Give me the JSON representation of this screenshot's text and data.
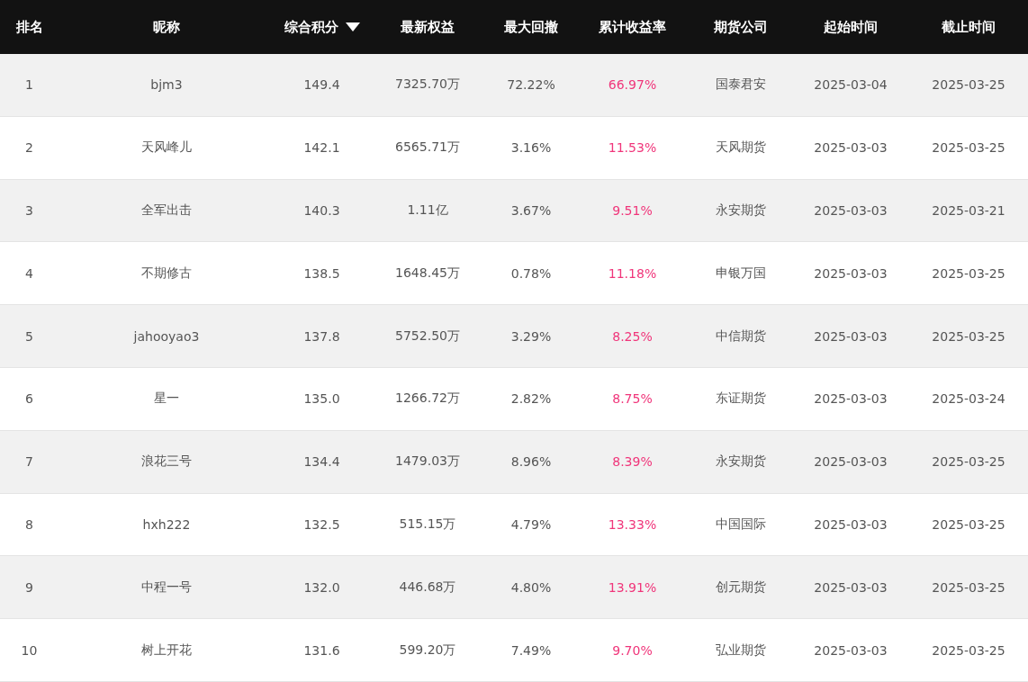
{
  "table": {
    "columns": [
      {
        "label": "排名"
      },
      {
        "label": "昵称"
      },
      {
        "label": "综合积分",
        "sorted": true
      },
      {
        "label": "最新权益"
      },
      {
        "label": "最大回撤"
      },
      {
        "label": "累计收益率"
      },
      {
        "label": "期货公司"
      },
      {
        "label": "起始时间"
      },
      {
        "label": "截止时间"
      }
    ],
    "rows": [
      [
        "1",
        "bjm3",
        "149.4",
        "7325.70万",
        "72.22%",
        "66.97%",
        "国泰君安",
        "2025-03-04",
        "2025-03-25"
      ],
      [
        "2",
        "天风峰儿",
        "142.1",
        "6565.71万",
        "3.16%",
        "11.53%",
        "天风期货",
        "2025-03-03",
        "2025-03-25"
      ],
      [
        "3",
        "全军出击",
        "140.3",
        "1.11亿",
        "3.67%",
        "9.51%",
        "永安期货",
        "2025-03-03",
        "2025-03-21"
      ],
      [
        "4",
        "不期修古",
        "138.5",
        "1648.45万",
        "0.78%",
        "11.18%",
        "申银万国",
        "2025-03-03",
        "2025-03-25"
      ],
      [
        "5",
        "jahooyao3",
        "137.8",
        "5752.50万",
        "3.29%",
        "8.25%",
        "中信期货",
        "2025-03-03",
        "2025-03-25"
      ],
      [
        "6",
        "星一",
        "135.0",
        "1266.72万",
        "2.82%",
        "8.75%",
        "东证期货",
        "2025-03-03",
        "2025-03-24"
      ],
      [
        "7",
        "浪花三号",
        "134.4",
        "1479.03万",
        "8.96%",
        "8.39%",
        "永安期货",
        "2025-03-03",
        "2025-03-25"
      ],
      [
        "8",
        "hxh222",
        "132.5",
        "515.15万",
        "4.79%",
        "13.33%",
        "中国国际",
        "2025-03-03",
        "2025-03-25"
      ],
      [
        "9",
        "中程一号",
        "132.0",
        "446.68万",
        "4.80%",
        "13.91%",
        "创元期货",
        "2025-03-03",
        "2025-03-25"
      ],
      [
        "10",
        "树上开花",
        "131.6",
        "599.20万",
        "7.49%",
        "9.70%",
        "弘业期货",
        "2025-03-03",
        "2025-03-25"
      ]
    ]
  }
}
